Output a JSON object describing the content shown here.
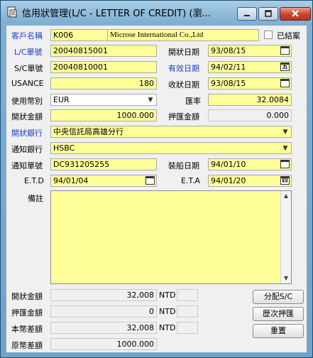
{
  "window": {
    "title": "信用狀管理(L/C  -  LETTER OF CREDIT) (瀏...",
    "min_glyph": "▁",
    "max_glyph": "▢",
    "close_glyph": "✕"
  },
  "form": {
    "customer": {
      "label": "客戶名稱",
      "code": "K006",
      "name": "Microse International Co.,Ltd"
    },
    "closed": {
      "label": "已結案",
      "checked": false
    },
    "lc_no": {
      "label": "L/C單號",
      "value": "20040815001"
    },
    "open_date": {
      "label": "開狀日期",
      "value": "93/08/15"
    },
    "sc_no": {
      "label": "S/C單號",
      "value": "20040810001"
    },
    "valid_date": {
      "label": "有效日期",
      "value": "94/02/11"
    },
    "usance": {
      "label": "USANCE",
      "value": "180"
    },
    "receive_date": {
      "label": "收狀日期",
      "value": "93/08/15"
    },
    "currency": {
      "label": "使用幣別",
      "value": "EUR"
    },
    "rate": {
      "label": "匯率",
      "value": "32.0084"
    },
    "open_amount": {
      "label": "開狀金額",
      "value": "1000.000"
    },
    "nego_amount": {
      "label": "押匯金額",
      "value": "0.000"
    },
    "open_bank": {
      "label": "開狀銀行",
      "value": "中央信託局高雄分行"
    },
    "advise_bank": {
      "label": "通知銀行",
      "value": "HSBC"
    },
    "advise_no": {
      "label": "通知單號",
      "value": "DC931205255"
    },
    "ship_date": {
      "label": "裝船日期",
      "value": "94/01/10"
    },
    "etd": {
      "label": "E.T.D",
      "value": "94/01/04"
    },
    "eta": {
      "label": "E.T.A",
      "value": "94/01/20"
    },
    "memo": {
      "label": "備註",
      "value": ""
    }
  },
  "summary": [
    {
      "label": "開狀金額",
      "value": "32,008",
      "unit": "NTD"
    },
    {
      "label": "押匯金額",
      "value": "0",
      "unit": "NTD"
    },
    {
      "label": "本幣差額",
      "value": "32,008",
      "unit": "NTD"
    },
    {
      "label": "原幣差額",
      "value": "1000.000",
      "unit": ""
    }
  ],
  "buttons": {
    "allocate": "分配S/C",
    "history": "歷次押匯",
    "reset": "重置"
  },
  "icons": {
    "calendar": "calendar-icon",
    "dropdown": "chevron-down-icon"
  },
  "calendar_glyphs": {
    "open": "▭",
    "valid": "五",
    "receive": "▭",
    "ship": "▭",
    "etd": "▭",
    "eta": "四"
  }
}
